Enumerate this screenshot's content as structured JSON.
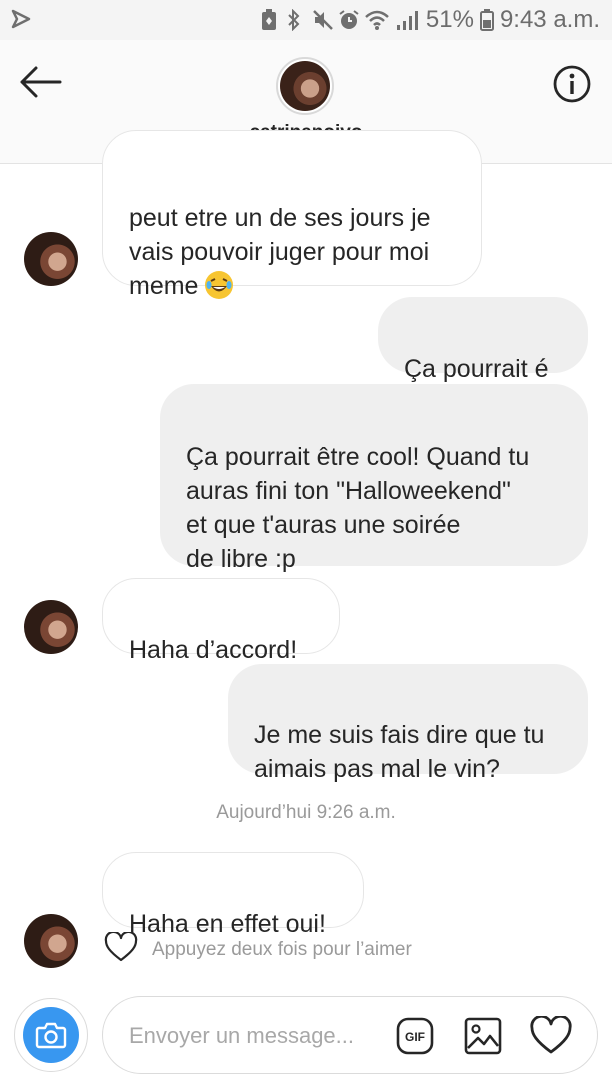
{
  "status_bar": {
    "battery": "51%",
    "time": "9:43 a.m.",
    "icons": [
      "notification-icon",
      "battery-saver-icon",
      "bluetooth-icon",
      "mute-icon",
      "alarm-icon",
      "wifi-icon",
      "signal-icon",
      "battery-icon"
    ]
  },
  "header": {
    "username": "catrinanoivo",
    "back_icon": "back-arrow-icon",
    "info_icon": "info-icon"
  },
  "messages": [
    {
      "direction": "in",
      "text": "peut etre un de ses jours je\nvais pouvoir juger pour moi\nmeme",
      "emoji": "laughing-tears-emoji"
    },
    {
      "direction": "out",
      "text": "Ça pourrait é"
    },
    {
      "direction": "out",
      "text": "Ça pourrait être cool! Quand tu\nauras fini ton \"Halloweekend\"\net que t'auras une soirée\nde libre :p"
    },
    {
      "direction": "in",
      "text": "Haha d’accord!"
    },
    {
      "direction": "out",
      "text": "Je me suis fais dire que tu\naimais pas mal le vin?"
    },
    {
      "direction": "in",
      "text": "Haha en effet oui!"
    }
  ],
  "timestamp": "Aujourd’hui 9:26 a.m.",
  "like_hint": "Appuyez deux fois pour l’aimer",
  "composer": {
    "placeholder": "Envoyer un message...",
    "gif_label": "GIF",
    "camera_icon": "camera-icon",
    "gallery_icon": "image-icon",
    "heart_icon": "heart-icon"
  },
  "colors": {
    "accent": "#3897f0",
    "outgoing_bubble": "#efefef",
    "meta_text": "#9a9a9a"
  }
}
